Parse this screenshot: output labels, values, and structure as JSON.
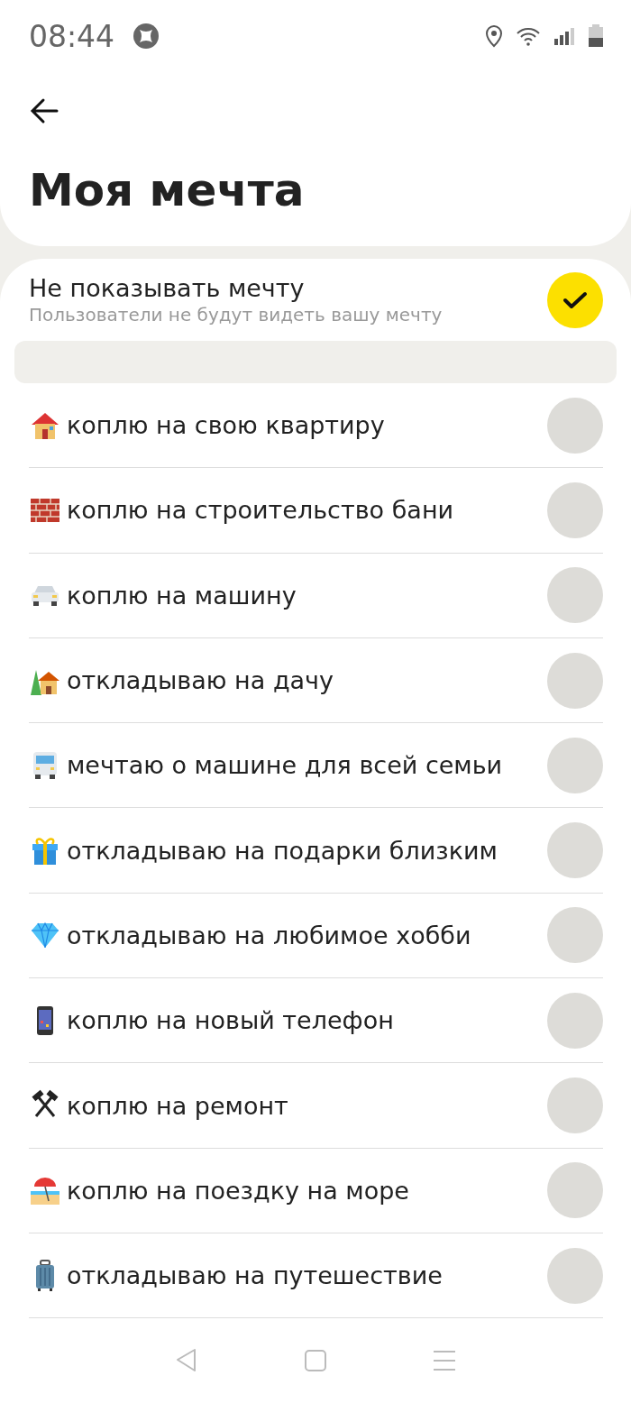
{
  "status_bar": {
    "time": "08:44"
  },
  "title": "Моя мечта",
  "hide_option": {
    "label": "Не показывать мечту",
    "sublabel": "Пользователи не будут видеть вашу мечту",
    "checked": true
  },
  "dreams": [
    {
      "kind": "house",
      "label": "коплю на свою квартиру",
      "selected": false
    },
    {
      "kind": "bricks",
      "label": "коплю на строительство бани",
      "selected": false
    },
    {
      "kind": "car",
      "label": "коплю на машину",
      "selected": false
    },
    {
      "kind": "cottage",
      "label": "откладываю на дачу",
      "selected": false
    },
    {
      "kind": "bus",
      "label": "мечтаю о машине для всей семьи",
      "selected": false
    },
    {
      "kind": "gift",
      "label": "откладываю на подарки близким",
      "selected": false
    },
    {
      "kind": "gem",
      "label": "откладываю на любимое хобби",
      "selected": false
    },
    {
      "kind": "phone",
      "label": "коплю на новый телефон",
      "selected": false
    },
    {
      "kind": "hammers",
      "label": "коплю на ремонт",
      "selected": false
    },
    {
      "kind": "beach",
      "label": "коплю на поездку на море",
      "selected": false
    },
    {
      "kind": "suitcase",
      "label": "откладываю на путешествие",
      "selected": false
    }
  ]
}
